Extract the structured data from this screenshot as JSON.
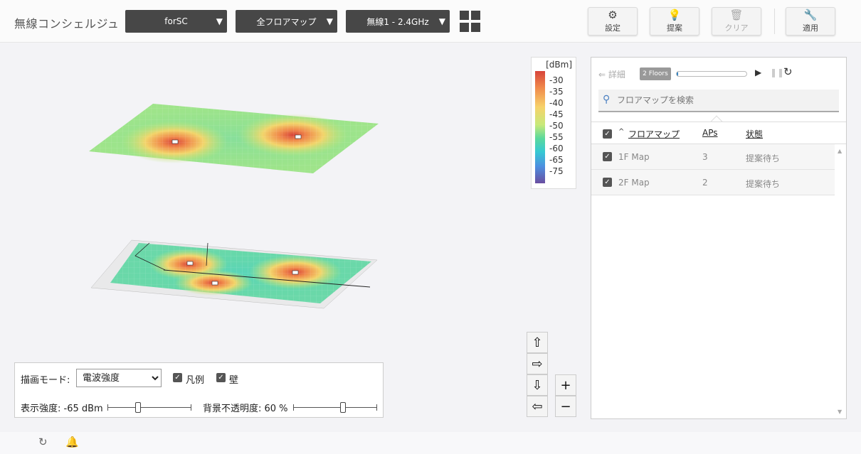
{
  "header": {
    "title": "無線コンシェルジュ",
    "dropdowns": [
      {
        "value": "forSC"
      },
      {
        "value": "全フロアマップ"
      },
      {
        "value": "無線1 - 2.4GHz"
      }
    ],
    "buttons": {
      "settings": "設定",
      "suggest": "提案",
      "clear": "クリア",
      "apply": "適用"
    }
  },
  "legend": {
    "unit": "[dBm]",
    "ticks": [
      "-30",
      "-35",
      "-40",
      "-45",
      "-50",
      "-55",
      "-60",
      "-65",
      "-75"
    ],
    "colors": [
      "#d7443a",
      "#f08a4b",
      "#f7d26a",
      "#c7e97a",
      "#5ad99c",
      "#36c9d3",
      "#4d8fe0",
      "#6a4ea0"
    ]
  },
  "panel": {
    "detail_label": "詳細",
    "floors_badge": "2 Floors",
    "progress_fraction": 0.02,
    "search_placeholder": "フロアマップを検索",
    "columns": {
      "floor_map": "フロアマップ",
      "aps": "APs",
      "status": "状態"
    },
    "rows": [
      {
        "name": "1F Map",
        "aps": "3",
        "status": "提案待ち"
      },
      {
        "name": "2F Map",
        "aps": "2",
        "status": "提案待ち"
      }
    ]
  },
  "controls": {
    "draw_mode_label": "描画モード:",
    "draw_mode_value": "電波強度",
    "legend_checkbox": "凡例",
    "wall_checkbox": "壁",
    "strength_label": "表示強度: -65 dBm",
    "strength_fraction": 0.35,
    "opacity_label": "背景不透明度: 60 %",
    "opacity_fraction": 0.6
  },
  "nav": {
    "up": "⇧",
    "right": "⇨",
    "down": "⇩",
    "left": "⇦",
    "zoom_in": "+",
    "zoom_out": "−"
  }
}
